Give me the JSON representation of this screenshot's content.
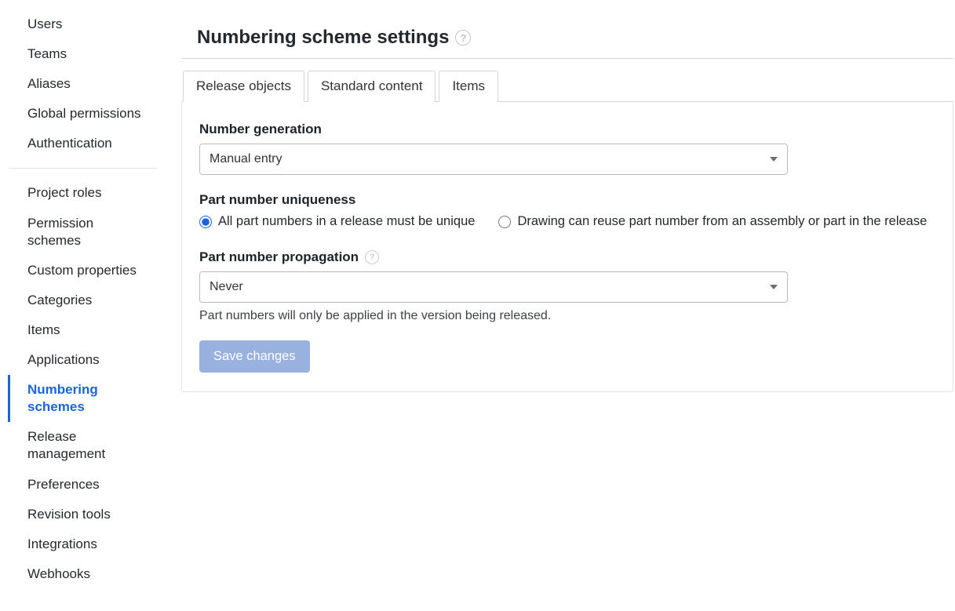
{
  "sidebar": {
    "group1": [
      {
        "label": "Users"
      },
      {
        "label": "Teams"
      },
      {
        "label": "Aliases"
      },
      {
        "label": "Global permissions"
      },
      {
        "label": "Authentication"
      }
    ],
    "group2": [
      {
        "label": "Project roles"
      },
      {
        "label": "Permission schemes"
      },
      {
        "label": "Custom properties"
      },
      {
        "label": "Categories"
      },
      {
        "label": "Items"
      },
      {
        "label": "Applications"
      },
      {
        "label": "Numbering schemes"
      },
      {
        "label": "Release management"
      },
      {
        "label": "Preferences"
      },
      {
        "label": "Revision tools"
      },
      {
        "label": "Integrations"
      },
      {
        "label": "Webhooks"
      }
    ],
    "active": "Numbering schemes"
  },
  "page": {
    "title": "Numbering scheme settings"
  },
  "tabs": [
    {
      "label": "Release objects"
    },
    {
      "label": "Standard content"
    },
    {
      "label": "Items"
    }
  ],
  "form": {
    "number_generation_label": "Number generation",
    "number_generation_value": "Manual entry",
    "uniqueness_label": "Part number uniqueness",
    "uniqueness_options": [
      "All part numbers in a release must be unique",
      "Drawing can reuse part number from an assembly or part in the release"
    ],
    "propagation_label": "Part number propagation",
    "propagation_value": "Never",
    "propagation_hint": "Part numbers will only be applied in the version being released.",
    "save_label": "Save changes"
  }
}
